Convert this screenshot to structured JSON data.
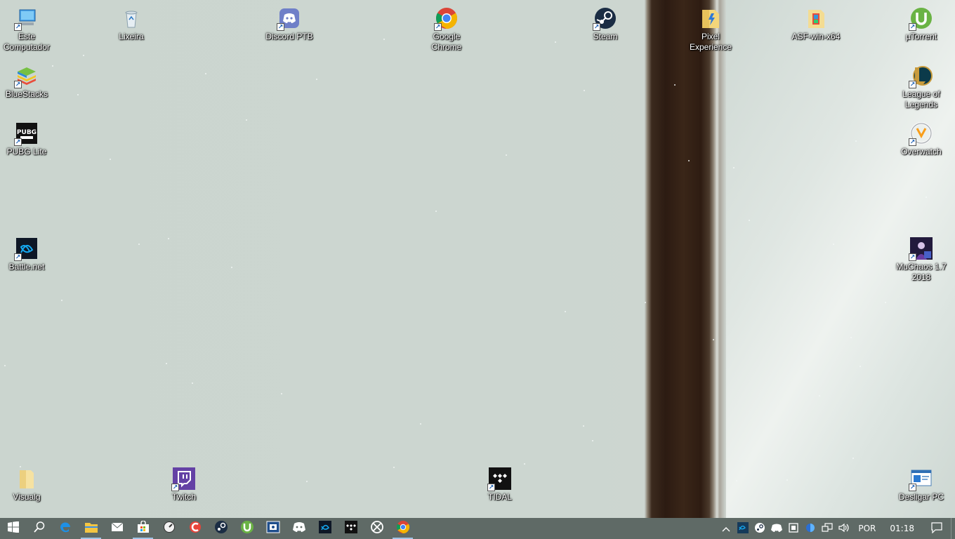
{
  "desktop_icons": [
    {
      "name": "este-computador",
      "label": "Este Computador",
      "icon": "computer-icon"
    },
    {
      "name": "lixeira",
      "label": "Lixeira",
      "icon": "recycle-bin-icon"
    },
    {
      "name": "discord-ptb",
      "label": "Discord PTB",
      "icon": "discord-icon"
    },
    {
      "name": "google-chrome",
      "label": "Google Chrome",
      "icon": "chrome-icon"
    },
    {
      "name": "steam",
      "label": "Steam",
      "icon": "steam-icon"
    },
    {
      "name": "pixel-experience",
      "label": "Pixel Experience",
      "icon": "folder-icon"
    },
    {
      "name": "asf-win-x64",
      "label": "ASF-win-x64",
      "icon": "folder-icon"
    },
    {
      "name": "utorrent",
      "label": "µTorrent",
      "icon": "utorrent-icon"
    },
    {
      "name": "bluestacks",
      "label": "BlueStacks",
      "icon": "bluestacks-icon"
    },
    {
      "name": "league-of-legends",
      "label": "League of Legends",
      "icon": "league-icon"
    },
    {
      "name": "pubg-lite",
      "label": "PUBG Lite",
      "icon": "pubg-icon"
    },
    {
      "name": "overwatch",
      "label": "Overwatch",
      "icon": "overwatch-icon"
    },
    {
      "name": "battle-net",
      "label": "Battle.net",
      "icon": "battlenet-icon"
    },
    {
      "name": "muchaos",
      "label": "MuChaos 1.7 2018",
      "icon": "muchaos-icon"
    },
    {
      "name": "visualg",
      "label": "Visualg",
      "icon": "folder-icon"
    },
    {
      "name": "twitch",
      "label": "Twitch",
      "icon": "twitch-icon"
    },
    {
      "name": "tidal",
      "label": "TIDAL",
      "icon": "tidal-icon"
    },
    {
      "name": "desligar-pc",
      "label": "Desligar PC",
      "icon": "shutdown-shortcut-icon"
    }
  ],
  "taskbar": {
    "pinned": [
      {
        "name": "start",
        "icon": "windows-start-icon"
      },
      {
        "name": "search",
        "icon": "search-icon"
      },
      {
        "name": "edge",
        "icon": "edge-icon"
      },
      {
        "name": "file-explorer",
        "icon": "file-explorer-icon",
        "active": true
      },
      {
        "name": "mail",
        "icon": "mail-icon"
      },
      {
        "name": "store",
        "icon": "store-icon"
      },
      {
        "name": "osu",
        "icon": "circle-app-icon"
      },
      {
        "name": "ccleaner",
        "icon": "ccleaner-icon"
      },
      {
        "name": "steam",
        "icon": "steam-icon"
      },
      {
        "name": "utorrent",
        "icon": "utorrent-icon"
      },
      {
        "name": "teamviewer",
        "icon": "box-app-icon"
      },
      {
        "name": "discord",
        "icon": "discord-icon"
      },
      {
        "name": "battlenet",
        "icon": "battlenet-icon"
      },
      {
        "name": "tidal",
        "icon": "tidal-icon"
      },
      {
        "name": "xbox",
        "icon": "xbox-icon"
      },
      {
        "name": "chrome",
        "icon": "chrome-icon",
        "active": true
      }
    ],
    "tray": {
      "language": "POR",
      "time": "01:18"
    }
  },
  "colors": {
    "taskbar": "#5f6a66",
    "desktop": "#cbd5cf",
    "trunk": "#2c1b12",
    "active_indicator": "#9ec3e6"
  }
}
